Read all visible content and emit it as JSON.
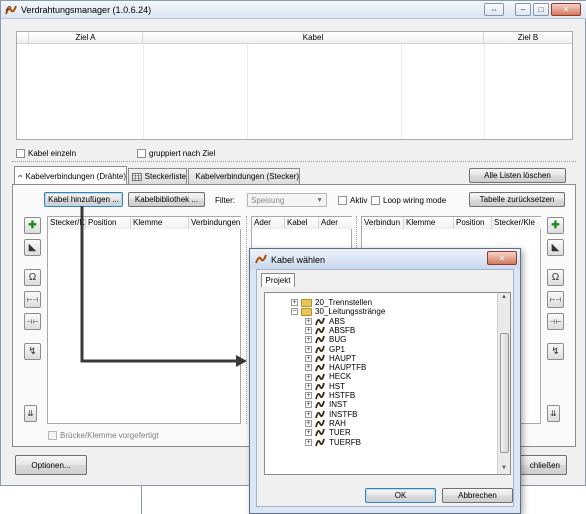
{
  "window": {
    "title": "Verdrahtungsmanager (1.0.6.24)"
  },
  "top_grid": {
    "columns": [
      "Ziel A",
      "Kabel",
      "Ziel B"
    ]
  },
  "options": {
    "kabel_einzeln": "Kabel einzeln",
    "gruppiert": "gruppiert nach Ziel"
  },
  "tabs": [
    {
      "label": "Kabelverbindungen (Drähte)"
    },
    {
      "label": "Steckerliste"
    },
    {
      "label": "Kabelverbindungen (Stecker)"
    }
  ],
  "toolbar": {
    "clear_all": "Alle Listen löschen",
    "add_cable": "Kabel hinzufügen ...",
    "cable_library": "Kabelbibliothek ...",
    "filter_label": "Filter:",
    "filter_value": "Speisung",
    "aktiv": "Aktiv",
    "loop_wiring": "Loop wiring mode",
    "reset_table": "Tabelle zurücksetzen"
  },
  "left_list": {
    "columns": [
      "Stecker/Kle",
      "Position",
      "Klemme",
      "Verbindungen"
    ]
  },
  "middle_list": {
    "columns": [
      "Ader",
      "Kabel",
      "Ader"
    ]
  },
  "right_list": {
    "columns": [
      "Verbindun",
      "Klemme",
      "Position",
      "Stecker/Kle"
    ]
  },
  "bridge_label": "Brücke/Klemme vorgefertigt",
  "footer": {
    "options": "Optionen...",
    "close": "chließen"
  },
  "dialog": {
    "title": "Kabel wählen",
    "tab": "Projekt",
    "folders": [
      "20_Trennstellen",
      "30_Leitungsstränge"
    ],
    "items": [
      "ABS",
      "ABSFB",
      "BUG",
      "GP1",
      "HAUPT",
      "HAUPTFB",
      "HECK",
      "HST",
      "HSTFB",
      "INST",
      "INSTFB",
      "RAH",
      "TUER",
      "TUERFB"
    ],
    "ok": "OK",
    "cancel": "Abbrechen"
  }
}
